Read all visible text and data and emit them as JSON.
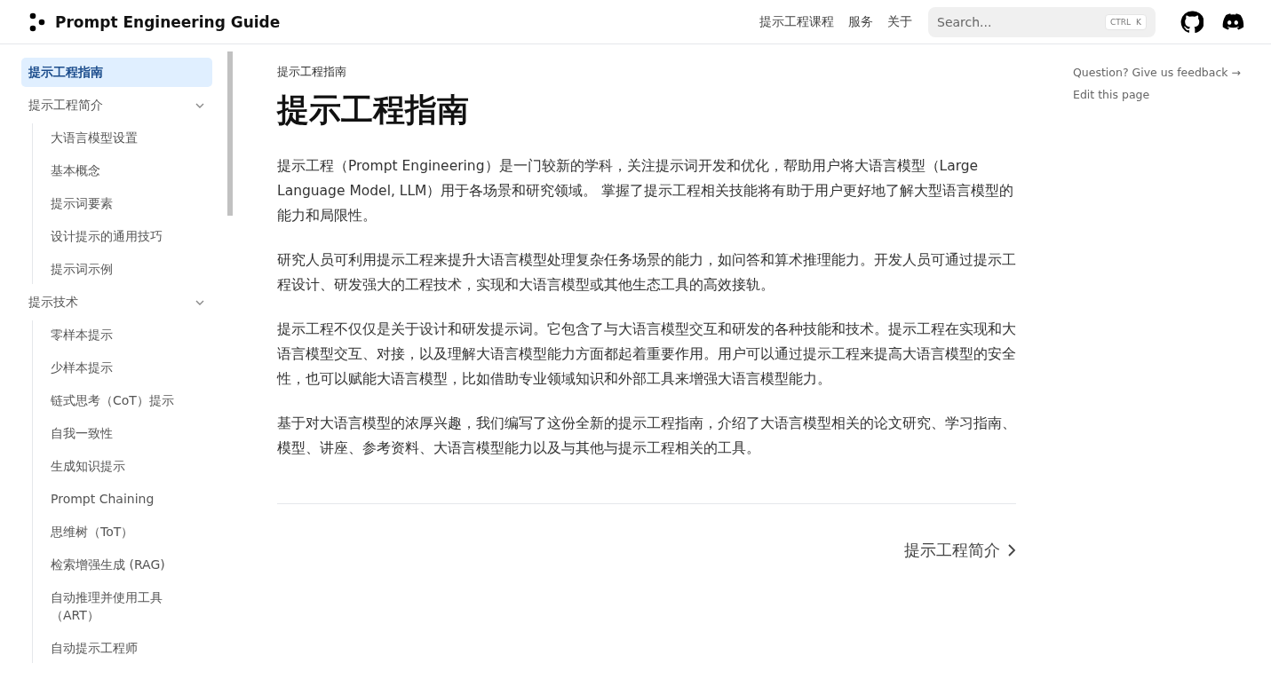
{
  "header": {
    "logo_text": "Prompt Engineering Guide",
    "nav": [
      "提示工程课程",
      "服务",
      "关于"
    ],
    "search": {
      "placeholder": "Search...",
      "shortcut": [
        "CTRL",
        "K"
      ]
    }
  },
  "sidebar": {
    "items": [
      {
        "label": "提示工程指南",
        "selected": true
      },
      {
        "label": "提示工程简介",
        "selected": false,
        "expanded": true,
        "children": [
          {
            "label": "大语言模型设置",
            "selected": false
          },
          {
            "label": "基本概念",
            "selected": false
          },
          {
            "label": "提示词要素",
            "selected": false
          },
          {
            "label": "设计提示的通用技巧",
            "selected": false
          },
          {
            "label": "提示词示例",
            "selected": false
          }
        ]
      },
      {
        "label": "提示技术",
        "selected": false,
        "expanded": true,
        "children": [
          {
            "label": "零样本提示",
            "selected": false
          },
          {
            "label": "少样本提示",
            "selected": false
          },
          {
            "label": "链式思考（CoT）提示",
            "selected": false
          },
          {
            "label": "自我一致性",
            "selected": false
          },
          {
            "label": "生成知识提示",
            "selected": false
          },
          {
            "label": "Prompt Chaining",
            "selected": false
          },
          {
            "label": "思维树（ToT）",
            "selected": false
          },
          {
            "label": "检索增强生成 (RAG)",
            "selected": false
          },
          {
            "label": "自动推理并使用工具（ART）",
            "selected": false
          },
          {
            "label": "自动提示工程师",
            "selected": false
          }
        ]
      }
    ]
  },
  "article": {
    "breadcrumb": "提示工程指南",
    "title": "提示工程指南",
    "paragraphs": [
      "提示工程（Prompt Engineering）是一门较新的学科，关注提示词开发和优化，帮助用户将大语言模型（Large Language Model, LLM）用于各场景和研究领域。 掌握了提示工程相关技能将有助于用户更好地了解大型语言模型的能力和局限性。",
      "研究人员可利用提示工程来提升大语言模型处理复杂任务场景的能力，如问答和算术推理能力。开发人员可通过提示工程设计、研发强大的工程技术，实现和大语言模型或其他生态工具的高效接轨。",
      "提示工程不仅仅是关于设计和研发提示词。它包含了与大语言模型交互和研发的各种技能和技术。提示工程在实现和大语言模型交互、对接，以及理解大语言模型能力方面都起着重要作用。用户可以通过提示工程来提高大语言模型的安全性，也可以赋能大语言模型，比如借助专业领域知识和外部工具来增强大语言模型能力。",
      "基于对大语言模型的浓厚兴趣，我们编写了这份全新的提示工程指南，介绍了大语言模型相关的论文研究、学习指南、模型、讲座、参考资料、大语言模型能力以及与其他与提示工程相关的工具。"
    ],
    "next_link": "提示工程简介"
  },
  "toc_links": [
    "Question? Give us feedback →",
    "Edit this page"
  ]
}
